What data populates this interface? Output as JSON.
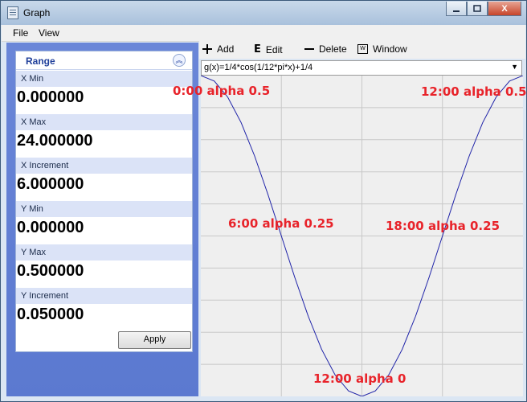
{
  "window": {
    "title": "Graph",
    "close_glyph": "X"
  },
  "menu": {
    "items": [
      "File",
      "View"
    ]
  },
  "range_panel": {
    "title": "Range",
    "fields": [
      {
        "label": "X Min",
        "value": "0.000000"
      },
      {
        "label": "X Max",
        "value": "24.000000"
      },
      {
        "label": "X Increment",
        "value": "6.000000"
      },
      {
        "label": "Y Min",
        "value": "0.000000"
      },
      {
        "label": "Y Max",
        "value": "0.500000"
      },
      {
        "label": "Y Increment",
        "value": "0.050000"
      }
    ],
    "apply_label": "Apply"
  },
  "toolbar": {
    "add": "Add",
    "edit": "Edit",
    "delete": "Delete",
    "window": "Window"
  },
  "function_select": {
    "value": "g(x)=1/4*cos(1/12*pi*x)+1/4"
  },
  "plot": {
    "curve_color": "#1e22a8",
    "grid_color": "#c8c8c8",
    "annotation_color": "#e8232a"
  },
  "annotations": [
    {
      "text": "0:00 alpha 0.5"
    },
    {
      "text": "12:00 alpha 0.5"
    },
    {
      "text": "6:00 alpha 0.25"
    },
    {
      "text": "18:00 alpha 0.25"
    },
    {
      "text": "12:00 alpha 0"
    }
  ],
  "chart_data": {
    "type": "line",
    "title": "",
    "xlabel": "",
    "ylabel": "",
    "xlim": [
      0,
      24
    ],
    "ylim": [
      0,
      0.5
    ],
    "x_increment": 6,
    "y_increment": 0.05,
    "grid": true,
    "series": [
      {
        "x": [
          0,
          1,
          2,
          3,
          4,
          5,
          6,
          7,
          8,
          9,
          10,
          11,
          12,
          13,
          14,
          15,
          16,
          17,
          18,
          19,
          20,
          21,
          22,
          23,
          24
        ],
        "values": [
          0.5,
          0.4915,
          0.4665,
          0.4268,
          0.375,
          0.3147,
          0.25,
          0.1853,
          0.125,
          0.0732,
          0.0335,
          0.0085,
          0,
          0.0085,
          0.0335,
          0.0732,
          0.125,
          0.1853,
          0.25,
          0.3147,
          0.375,
          0.4268,
          0.4665,
          0.4915,
          0.5
        ]
      }
    ]
  }
}
